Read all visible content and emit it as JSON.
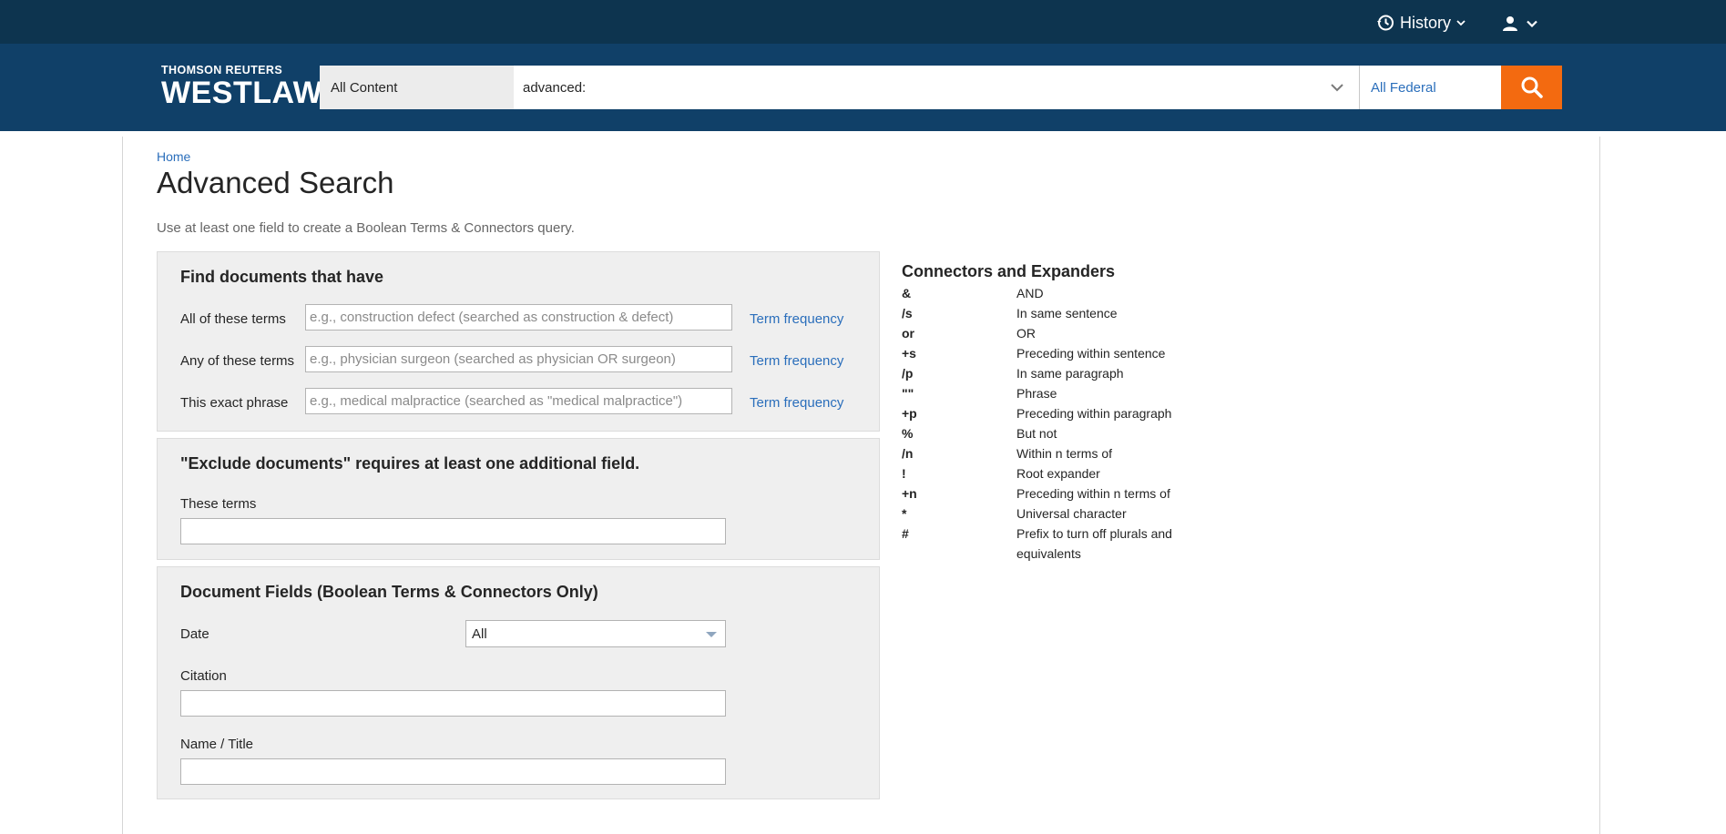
{
  "topbar": {
    "history_label": "History"
  },
  "header": {
    "logo_top": "THOMSON REUTERS",
    "logo_main": "WESTLAW",
    "content_select": "All Content",
    "search_value": "advanced:",
    "jurisdiction": "All Federal"
  },
  "page": {
    "breadcrumb": "Home",
    "title": "Advanced Search",
    "intro": "Use at least one field to create a Boolean Terms & Connectors query."
  },
  "find_panel": {
    "title": "Find documents that have",
    "rows": [
      {
        "label": "All of these terms",
        "placeholder": "e.g., construction defect (searched as construction & defect)",
        "link": "Term frequency"
      },
      {
        "label": "Any of these terms",
        "placeholder": "e.g., physician surgeon (searched as physician OR surgeon)",
        "link": "Term frequency"
      },
      {
        "label": "This exact phrase",
        "placeholder": "e.g., medical malpractice (searched as \"medical malpractice\")",
        "link": "Term frequency"
      }
    ]
  },
  "exclude_panel": {
    "title": "\"Exclude documents\" requires at least one additional field.",
    "field_label": "These terms"
  },
  "fields_panel": {
    "title": "Document Fields (Boolean Terms & Connectors Only)",
    "date_label": "Date",
    "date_value": "All",
    "citation_label": "Citation",
    "name_label": "Name / Title"
  },
  "connectors": {
    "title": "Connectors and Expanders",
    "items": [
      {
        "symbol": "&",
        "desc": "AND"
      },
      {
        "symbol": "/s",
        "desc": "In same sentence"
      },
      {
        "symbol": "or",
        "desc": "OR"
      },
      {
        "symbol": "+s",
        "desc": "Preceding within sentence"
      },
      {
        "symbol": "/p",
        "desc": "In same paragraph"
      },
      {
        "symbol": "\"\"",
        "desc": "Phrase"
      },
      {
        "symbol": "+p",
        "desc": "Preceding within paragraph"
      },
      {
        "symbol": "%",
        "desc": "But not"
      },
      {
        "symbol": "/n",
        "desc": "Within n terms of"
      },
      {
        "symbol": "!",
        "desc": "Root expander"
      },
      {
        "symbol": "+n",
        "desc": "Preceding within n terms of"
      },
      {
        "symbol": "*",
        "desc": "Universal character"
      },
      {
        "symbol": "#",
        "desc": "Prefix to turn off plurals and equivalents"
      }
    ]
  },
  "colors": {
    "topbar": "#0d344f",
    "header": "#104068",
    "accent_orange": "#f36a10",
    "link_blue": "#2a6ebb"
  }
}
